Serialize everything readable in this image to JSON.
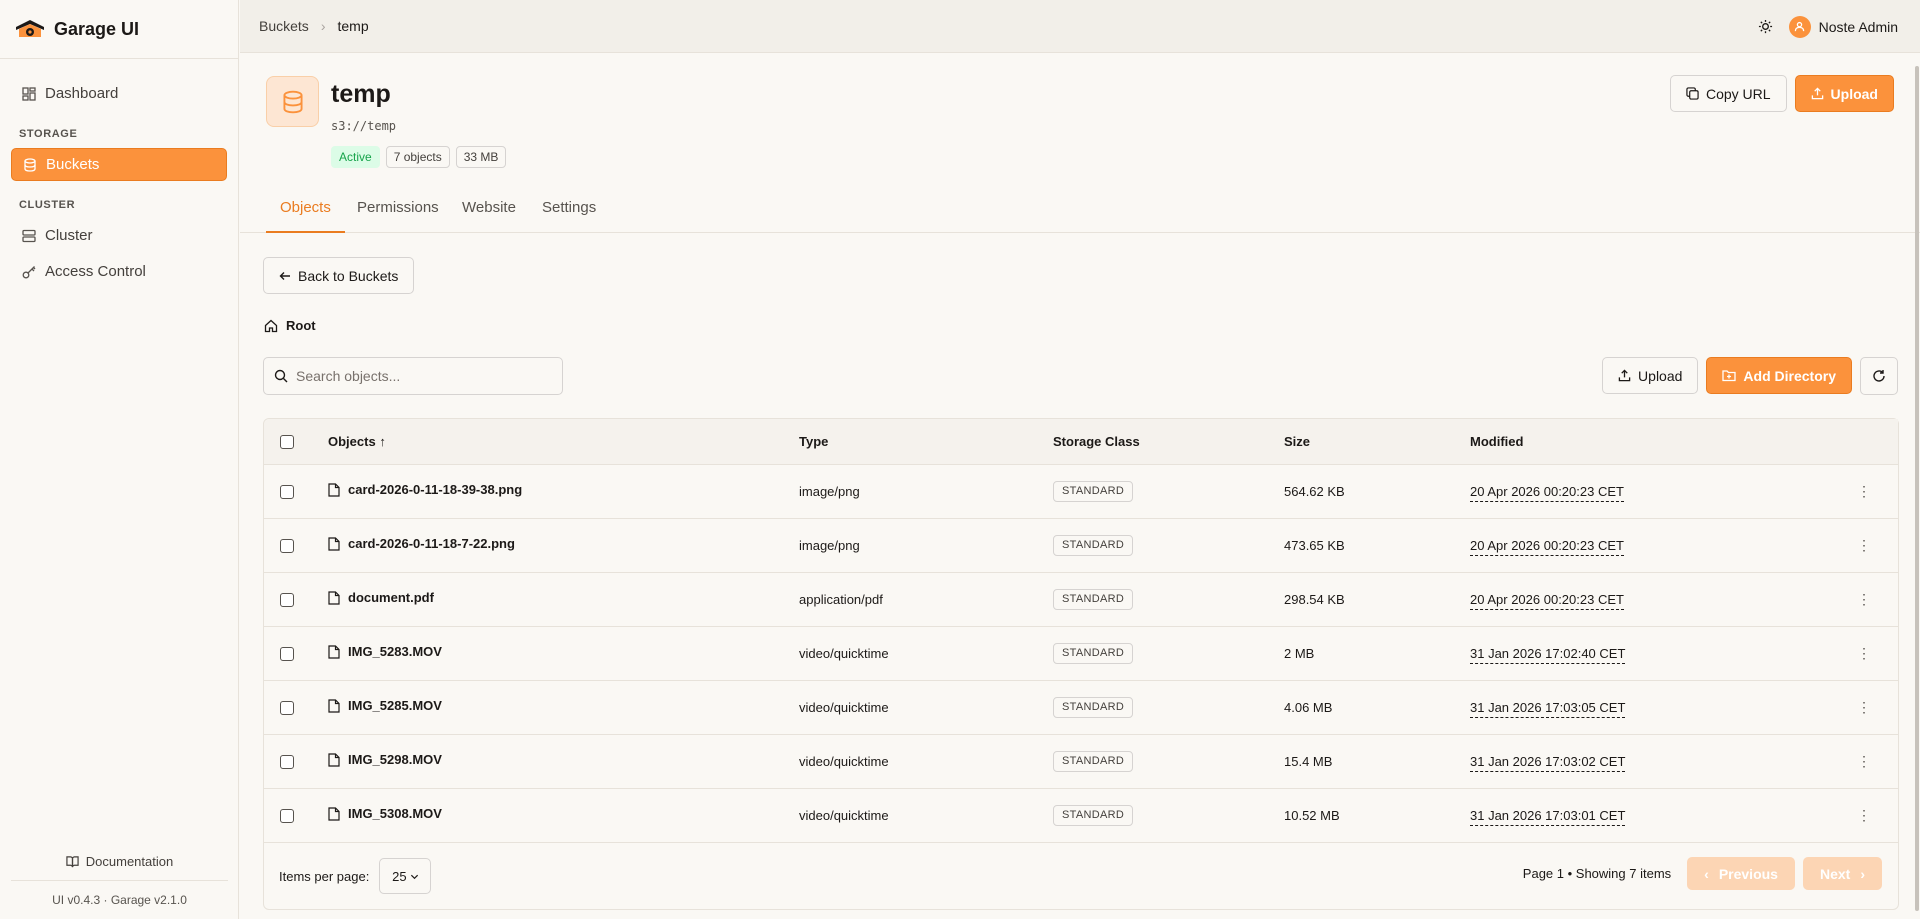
{
  "app": {
    "name": "Garage UI"
  },
  "sidebar": {
    "items": [
      {
        "label": "Dashboard",
        "icon": "dashboard-icon"
      },
      {
        "label": "Buckets",
        "icon": "database-icon",
        "active": true
      },
      {
        "label": "Cluster",
        "icon": "server-icon"
      },
      {
        "label": "Access Control",
        "icon": "key-icon"
      }
    ],
    "sections": {
      "storage": "STORAGE",
      "cluster": "CLUSTER"
    },
    "documentation": "Documentation",
    "version": "UI v0.4.3 · Garage v2.1.0"
  },
  "header": {
    "breadcrumb": [
      "Buckets",
      "temp"
    ],
    "user": "Noste Admin"
  },
  "bucket": {
    "name": "temp",
    "path": "s3://temp",
    "status": "Active",
    "objects": "7 objects",
    "size": "33 MB",
    "copy_url": "Copy URL",
    "upload": "Upload"
  },
  "tabs": [
    "Objects",
    "Permissions",
    "Website",
    "Settings"
  ],
  "browser": {
    "back": "Back to Buckets",
    "root": "Root",
    "search_placeholder": "Search objects...",
    "upload": "Upload",
    "add_directory": "Add Directory"
  },
  "table": {
    "columns": [
      "Objects",
      "Type",
      "Storage Class",
      "Size",
      "Modified"
    ],
    "rows": [
      {
        "name": "card-2026-0-11-18-39-38.png",
        "type": "image/png",
        "storage_class": "STANDARD",
        "size": "564.62 KB",
        "modified": "20 Apr 2026 00:20:23 CET"
      },
      {
        "name": "card-2026-0-11-18-7-22.png",
        "type": "image/png",
        "storage_class": "STANDARD",
        "size": "473.65 KB",
        "modified": "20 Apr 2026 00:20:23 CET"
      },
      {
        "name": "document.pdf",
        "type": "application/pdf",
        "storage_class": "STANDARD",
        "size": "298.54 KB",
        "modified": "20 Apr 2026 00:20:23 CET"
      },
      {
        "name": "IMG_5283.MOV",
        "type": "video/quicktime",
        "storage_class": "STANDARD",
        "size": "2 MB",
        "modified": "31 Jan 2026 17:02:40 CET"
      },
      {
        "name": "IMG_5285.MOV",
        "type": "video/quicktime",
        "storage_class": "STANDARD",
        "size": "4.06 MB",
        "modified": "31 Jan 2026 17:03:05 CET"
      },
      {
        "name": "IMG_5298.MOV",
        "type": "video/quicktime",
        "storage_class": "STANDARD",
        "size": "15.4 MB",
        "modified": "31 Jan 2026 17:03:02 CET"
      },
      {
        "name": "IMG_5308.MOV",
        "type": "video/quicktime",
        "storage_class": "STANDARD",
        "size": "10.52 MB",
        "modified": "31 Jan 2026 17:03:01 CET"
      }
    ]
  },
  "pagination": {
    "items_per_page_label": "Items per page:",
    "items_per_page": "25",
    "info": "Page 1 • Showing 7 items",
    "previous": "Previous",
    "next": "Next"
  },
  "colors": {
    "accent": "#fb923c",
    "accent_dark": "#ea7c20",
    "success": "#16a34a"
  }
}
